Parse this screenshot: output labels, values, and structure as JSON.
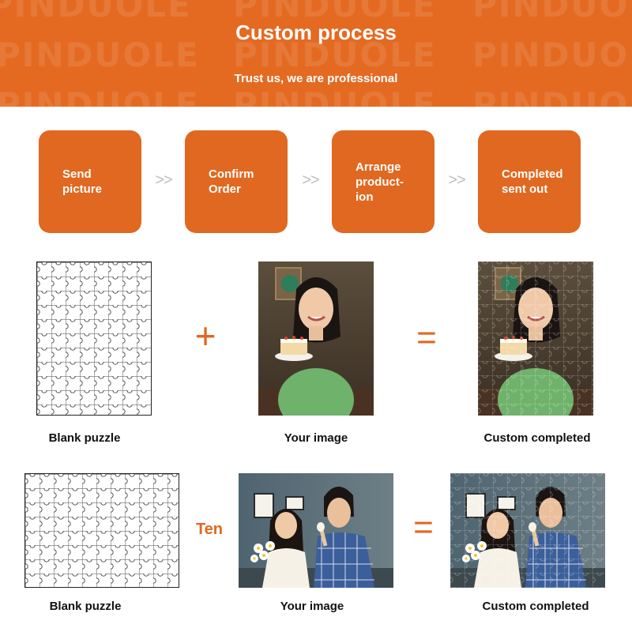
{
  "banner": {
    "title": "Custom process",
    "subtitle": "Trust us, we are professional",
    "watermark": "PINDUOLE",
    "color": "#e46a22"
  },
  "steps": [
    {
      "label": "Send\npicture"
    },
    {
      "label": "Confirm\nOrder"
    },
    {
      "label": "Arrange\nproduct-\nion"
    },
    {
      "label": "Completed\nsent out"
    }
  ],
  "step_arrow": ">>",
  "row1": {
    "operator_plus": "+",
    "operator_equals": "=",
    "captions": [
      "Blank puzzle",
      "Your image",
      "Custom completed"
    ]
  },
  "row2": {
    "operator_text": "Ten",
    "operator_equals": "=",
    "captions": [
      "Blank puzzle",
      "Your image",
      "Custom completed"
    ]
  },
  "colors": {
    "accent": "#e06820",
    "arrow": "#bdbdbd",
    "text": "#111111"
  }
}
